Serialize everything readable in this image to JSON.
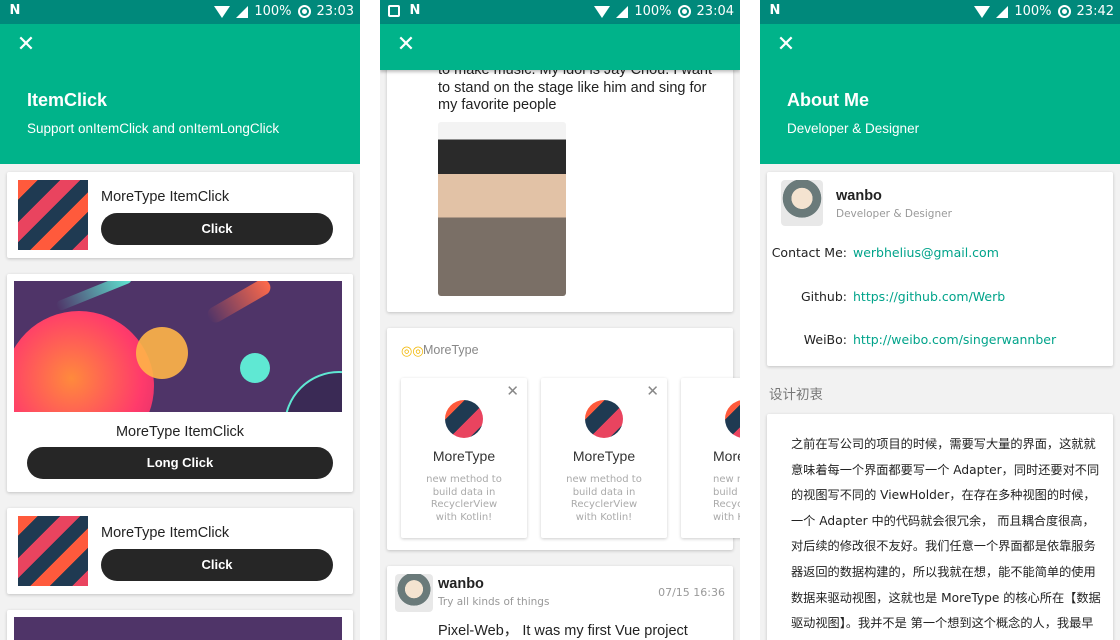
{
  "colors": {
    "accent": "#00b38a",
    "statusbar": "#00897b",
    "button": "#262626"
  },
  "status": [
    {
      "battery": "100%",
      "time": "23:03"
    },
    {
      "battery": "100%",
      "time": "23:04"
    },
    {
      "battery": "100%",
      "time": "23:42"
    }
  ],
  "screen1": {
    "title": "ItemClick",
    "subtitle": "Support onItemClick and onItemLongClick",
    "items": [
      {
        "label": "MoreType ItemClick",
        "button": "Click"
      },
      {
        "label": "MoreType ItemClick",
        "button": "Long Click"
      },
      {
        "label": "MoreType ItemClick",
        "button": "Click"
      }
    ]
  },
  "screen2": {
    "post_text": "to make music. My idol is Jay Chou. I want to stand on the stage like him and sing for my favorite people",
    "section_title": "MoreType",
    "cards": [
      {
        "title": "MoreType",
        "desc": "new method to build data in RecyclerView with Kotlin!"
      },
      {
        "title": "MoreType",
        "desc": "new method to build data in RecyclerView with Kotlin!"
      },
      {
        "title": "MoreType",
        "desc": "new method to build data in RecyclerView with Kotlin!"
      }
    ],
    "post2": {
      "author": "wanbo",
      "tagline": "Try all kinds of things",
      "time": "07/15 16:36",
      "text": "Pixel-Web， It was my first Vue project"
    }
  },
  "screen3": {
    "title": "About Me",
    "subtitle": "Developer & Designer",
    "name": "wanbo",
    "role": "Developer & Designer",
    "contacts": [
      {
        "label": "Contact Me:",
        "value": "werbhelius@gmail.com"
      },
      {
        "label": "Github:",
        "value": "https://github.com/Werb"
      },
      {
        "label": "WeiBo:",
        "value": "http://weibo.com/singerwannber"
      }
    ],
    "section_title": "设计初衷",
    "body": "之前在写公司的项目的时候，需要写大量的界面，这就就意味着每一个界面都要写一个 Adapter，同时还要对不同的视图写不同的 ViewHolder，在存在多种视图的时候，一个 Adapter 中的代码就会很冗余， 而且耦合度很高，对后续的修改很不友好。我们任意一个界面都是依靠服务器返回的数据构建的，所以我就在想，能不能简单的使用数据来驱动视图，这就也是 MoreType 的核心所在【数据驱动视图】。我并不是 第一个想到这个概念的人，我最早看到"
  }
}
